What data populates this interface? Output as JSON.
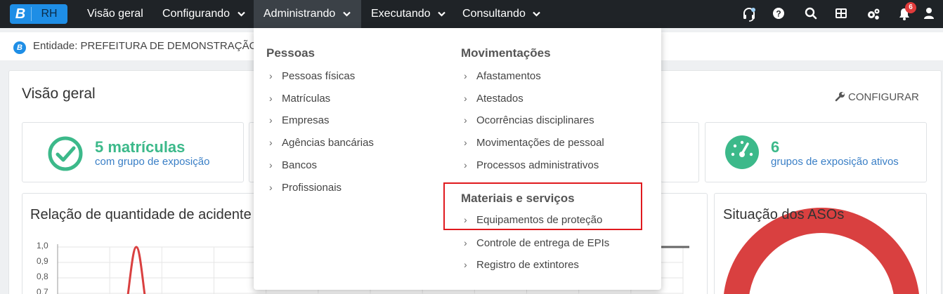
{
  "app": {
    "logo_letter": "B",
    "logo_text": "RH"
  },
  "nav": {
    "items": [
      {
        "label": "Visão geral"
      },
      {
        "label": "Configurando"
      },
      {
        "label": "Administrando"
      },
      {
        "label": "Executando"
      },
      {
        "label": "Consultando"
      }
    ]
  },
  "toolbar": {
    "notifications_count": "6",
    "icons": [
      "headset-icon",
      "help-icon",
      "search-icon",
      "apps-grid-icon",
      "settings-icon",
      "bell-icon",
      "user-icon"
    ]
  },
  "entity": {
    "icon_letter": "B",
    "label": "Entidade: PREFEITURA DE DEMONSTRAÇÃO"
  },
  "page": {
    "title": "Visão geral",
    "configure_label": "CONFIGURAR"
  },
  "stats": [
    {
      "value": "5 matrículas",
      "desc": "com grupo de exposição",
      "icon": "check-circle-icon"
    },
    {
      "value": "6",
      "desc": "grupos de exposição ativos",
      "icon": "gauge-icon"
    }
  ],
  "panels": {
    "accidents_title": "Relação de quantidade de acidente",
    "aso_title": "Situação dos ASOs",
    "y_ticks": [
      "1,0",
      "0,9",
      "0,8",
      "0,7"
    ]
  },
  "chart_data": {
    "type": "line",
    "title": "Relação de quantidade de acidente",
    "y_ticks": [
      "1,0",
      "0,9",
      "0,8",
      "0,7"
    ],
    "ylim": [
      0.7,
      1.0
    ],
    "series": [
      {
        "values": [
          0.7,
          1.0,
          0.7
        ]
      }
    ]
  },
  "dropdown": {
    "col1_heading": "Pessoas",
    "col1_items": [
      "Pessoas físicas",
      "Matrículas",
      "Empresas",
      "Agências bancárias",
      "Bancos",
      "Profissionais"
    ],
    "col2_heading": "Movimentações",
    "col2_items": [
      "Afastamentos",
      "Atestados",
      "Ocorrências disciplinares",
      "Movimentações de pessoal",
      "Processos administrativos"
    ],
    "col3_heading": "Materiais e serviços",
    "col3_items": [
      "Equipamentos de proteção",
      "Controle de entrega de EPIs",
      "Registro de extintores"
    ],
    "arrow": "›"
  },
  "colors": {
    "topbar": "#1f2327",
    "brand": "#1e8ee6",
    "success": "#3cb98a",
    "link": "#3a7fc6",
    "chart_red": "#d94040",
    "highlight": "#e0191e"
  }
}
